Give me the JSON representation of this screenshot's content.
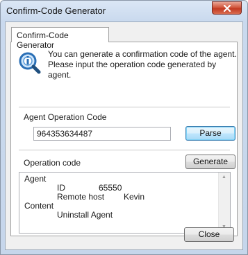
{
  "window": {
    "title": "Confirm-Code Generator"
  },
  "tab": {
    "label": "Confirm-Code Generator"
  },
  "description": {
    "line1": "You can generate a confirmation code of the agent.",
    "line2": "Please input the operation code generated by agent."
  },
  "agent_operation": {
    "label": "Agent Operation Code",
    "value": "964353634487",
    "parse_label": "Parse"
  },
  "operation": {
    "label": "Operation code",
    "generate_label": "Generate",
    "output_lines": {
      "agent": "Agent",
      "id_key": "ID",
      "id_value": "65550",
      "host_key": "Remote host",
      "host_value": "Kevin",
      "content": "Content",
      "content_value": "Uninstall Agent"
    }
  },
  "footer": {
    "close_label": "Close"
  },
  "icons": {
    "info": "magnifier-info-icon",
    "close": "close-icon",
    "scroll_up": "scroll-up-arrow-icon",
    "scroll_down": "scroll-down-arrow-icon"
  },
  "colors": {
    "title_close": "#c23a22",
    "focus_button": "#bee6fd",
    "icon_blue": "#2a6fb6"
  }
}
